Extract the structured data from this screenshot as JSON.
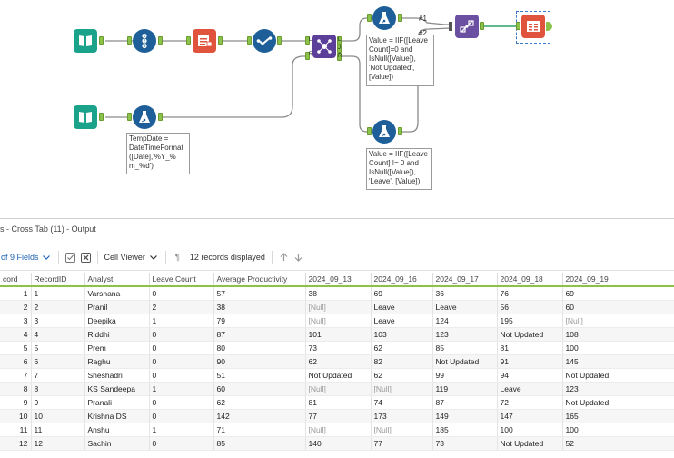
{
  "canvas": {
    "connection_labels": {
      "out1": "#1",
      "out2": "#2"
    },
    "join_anchor_labels": {
      "l_in": "L",
      "r_in": "R",
      "l_out": "L",
      "j_out": "J",
      "r_out": "R"
    },
    "annotations": {
      "formula_tempdate": "TempDate =\nDateTimeFormat\n([Date],'%Y_%\nm_%d')",
      "formula_not_updated": "Value = IIF([Leave\nCount]=0 and\nIsNull([Value]),\n'Not Updated',\n[Value])",
      "formula_leave": "Value = IIF([Leave\nCount] != 0 and\nIsNull([Value]),\n'Leave', [Value])"
    }
  },
  "results": {
    "panel_title": "s - Cross Tab (11) - Output",
    "toolbar": {
      "fields_label": "of 9 Fields",
      "cell_viewer_label": "Cell Viewer",
      "records_displayed": "12 records displayed"
    },
    "columns": [
      "cord",
      "RecordID",
      "Analyst",
      "Leave Count",
      "Average Productivity",
      "2024_09_13",
      "2024_09_16",
      "2024_09_17",
      "2024_09_18",
      "2024_09_19"
    ],
    "rows": [
      [
        "1",
        "1",
        "Varshana",
        "0",
        "57",
        "38",
        "69",
        "36",
        "76",
        "69"
      ],
      [
        "2",
        "2",
        "Pranil",
        "2",
        "38",
        "[Null]",
        "Leave",
        "Leave",
        "56",
        "60"
      ],
      [
        "3",
        "3",
        "Deepika",
        "1",
        "79",
        "[Null]",
        "Leave",
        "124",
        "195",
        "[Null]"
      ],
      [
        "4",
        "4",
        "Riddhi",
        "0",
        "87",
        "101",
        "103",
        "123",
        "Not Updated",
        "108"
      ],
      [
        "5",
        "5",
        "Prem",
        "0",
        "80",
        "73",
        "62",
        "85",
        "81",
        "100"
      ],
      [
        "6",
        "6",
        "Raghu",
        "0",
        "90",
        "62",
        "82",
        "Not Updated",
        "91",
        "145"
      ],
      [
        "7",
        "7",
        "Sheshadri",
        "0",
        "51",
        "Not Updated",
        "62",
        "99",
        "94",
        "Not Updated"
      ],
      [
        "8",
        "8",
        "KS Sandeepa",
        "1",
        "60",
        "[Null]",
        "[Null]",
        "119",
        "Leave",
        "123"
      ],
      [
        "9",
        "9",
        "Pranali",
        "0",
        "62",
        "81",
        "74",
        "87",
        "72",
        "Not Updated"
      ],
      [
        "10",
        "10",
        "Krishna DS",
        "0",
        "142",
        "77",
        "173",
        "149",
        "147",
        "165"
      ],
      [
        "11",
        "11",
        "Anshu",
        "1",
        "71",
        "[Null]",
        "[Null]",
        "185",
        "100",
        "100"
      ],
      [
        "12",
        "12",
        "Sachin",
        "0",
        "85",
        "140",
        "77",
        "73",
        "Not Updated",
        "52"
      ]
    ]
  },
  "colors": {
    "input_tool": "#1aa38a",
    "prep_tool": "#1e5f99",
    "developer_tool": "#e0533d",
    "join_tool": "#5b3f99",
    "transform_tool": "#6b4fa0",
    "anchor_green": "#8bc34a",
    "header_underline": "#8bc34a",
    "link_blue": "#1a5fb4"
  },
  "icons": [
    "book-input-icon",
    "record-id-icon",
    "select-records-icon",
    "select-icon",
    "formula-flask-icon",
    "join-icon",
    "cross-tab-icon",
    "browse-icon"
  ]
}
